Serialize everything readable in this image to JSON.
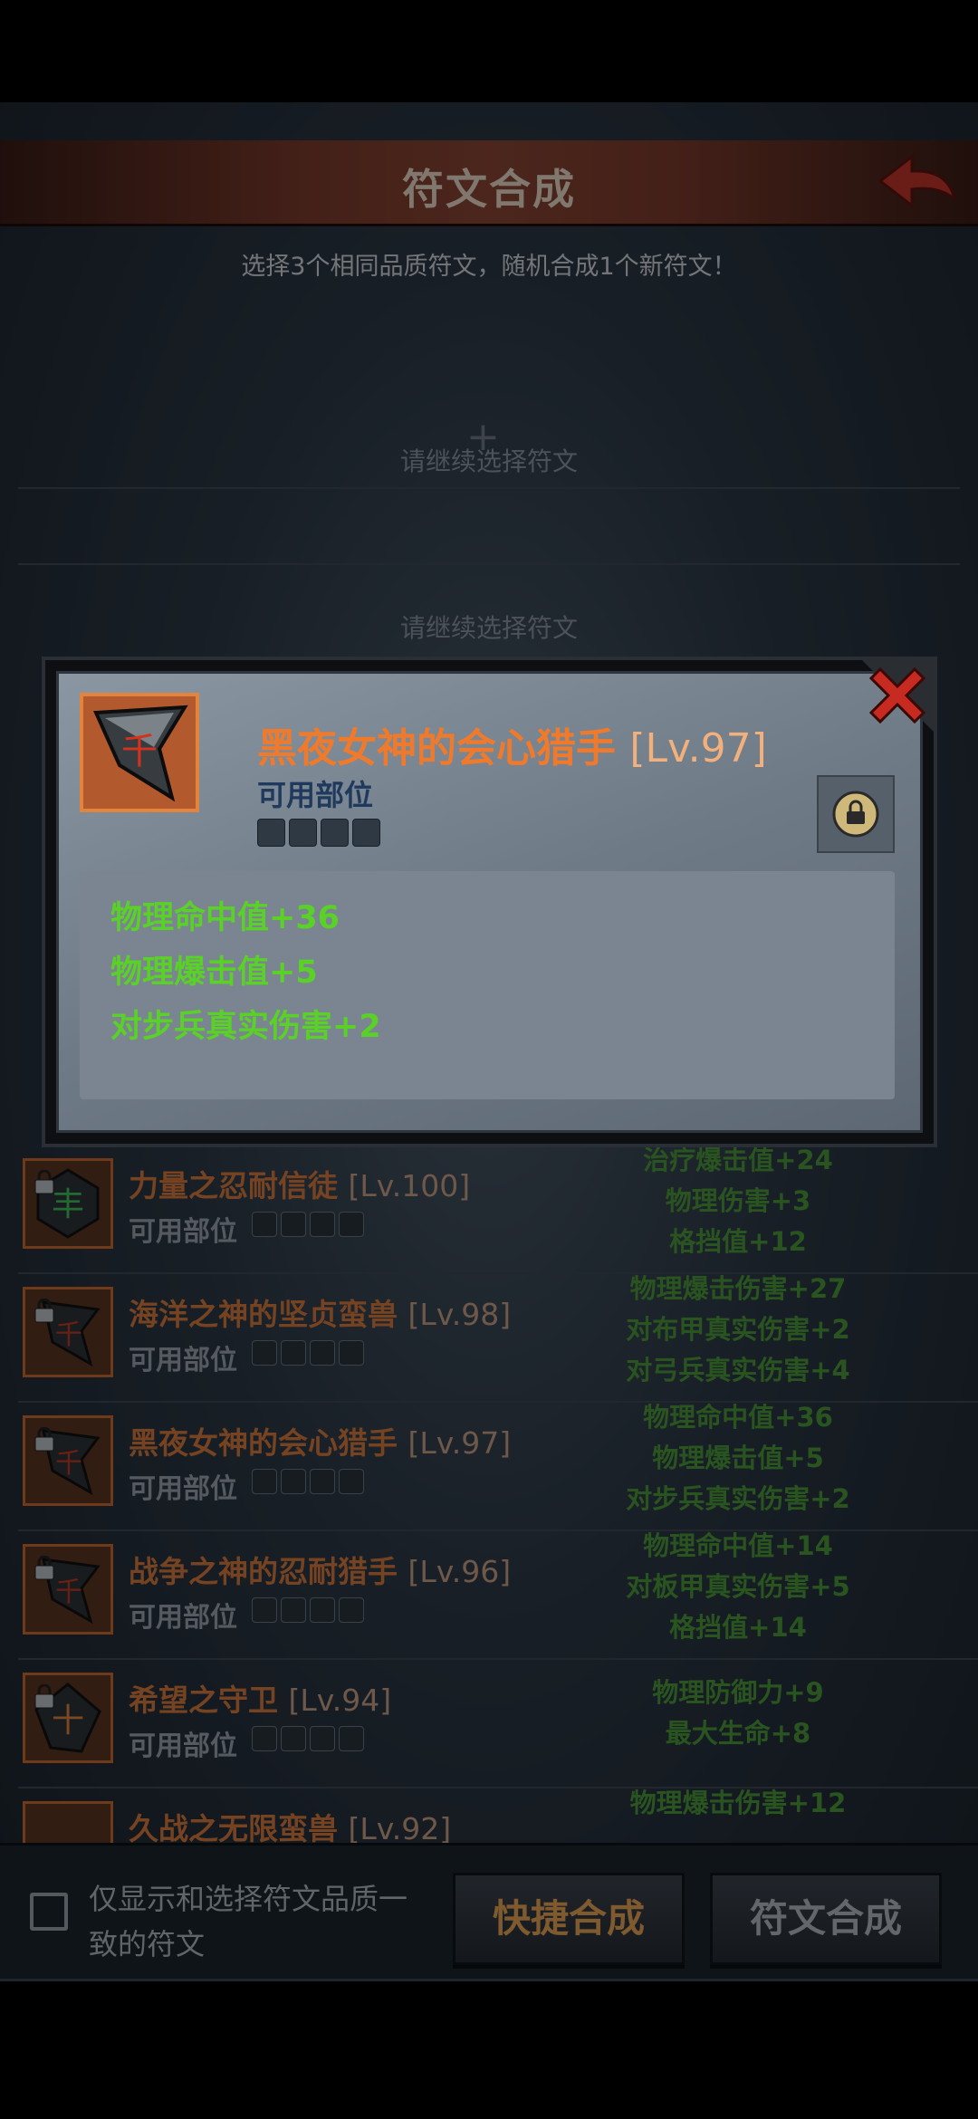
{
  "header": {
    "title": "符文合成"
  },
  "hint": "选择3个相同品质符文，随机合成1个新符文！",
  "slots": {
    "placeholder_1": "请继续选择符文",
    "plus": "+",
    "placeholder_2": "请继续选择符文"
  },
  "list": [
    {
      "name": "力量之忍耐信徒",
      "level": "[Lv.100]",
      "part_label": "可用部位",
      "glyph": "green",
      "stats": [
        "治疗爆击值+24",
        "物理伤害+3",
        "格挡值+12"
      ]
    },
    {
      "name": "海洋之神的坚贞蛮兽",
      "level": "[Lv.98]",
      "part_label": "可用部位",
      "glyph": "red",
      "stats": [
        "物理爆击伤害+27",
        "对布甲真实伤害+2",
        "对弓兵真实伤害+4"
      ]
    },
    {
      "name": "黑夜女神的会心猎手",
      "level": "[Lv.97]",
      "part_label": "可用部位",
      "glyph": "red",
      "stats": [
        "物理命中值+36",
        "物理爆击值+5",
        "对步兵真实伤害+2"
      ]
    },
    {
      "name": "战争之神的忍耐猎手",
      "level": "[Lv.96]",
      "part_label": "可用部位",
      "glyph": "red",
      "stats": [
        "物理命中值+14",
        "对板甲真实伤害+5",
        "格挡值+14"
      ]
    },
    {
      "name": "希望之守卫",
      "level": "[Lv.94]",
      "part_label": "可用部位",
      "glyph": "orange",
      "stats": [
        "物理防御力+9",
        "最大生命+8"
      ]
    },
    {
      "name": "久战之无限蛮兽",
      "level": "[Lv.92]",
      "part_label": "可用部位",
      "glyph": "red",
      "stats": [
        "物理爆击伤害+12"
      ]
    }
  ],
  "bottom": {
    "checkbox_label": "仅显示和选择符文品质一致的符文",
    "quick_button": "快捷合成",
    "merge_button": "符文合成"
  },
  "popup": {
    "name": "黑夜女神的会心猎手",
    "level": "[Lv.97]",
    "part_label": "可用部位",
    "stats": [
      "物理命中值+36",
      "物理爆击值+5",
      "对步兵真实伤害+2"
    ]
  },
  "colors": {
    "rune_name": "#d57a3c",
    "stat_green": "#4b9a3a",
    "popup_stat": "#5ad127",
    "accent_orange": "#e2843d"
  }
}
